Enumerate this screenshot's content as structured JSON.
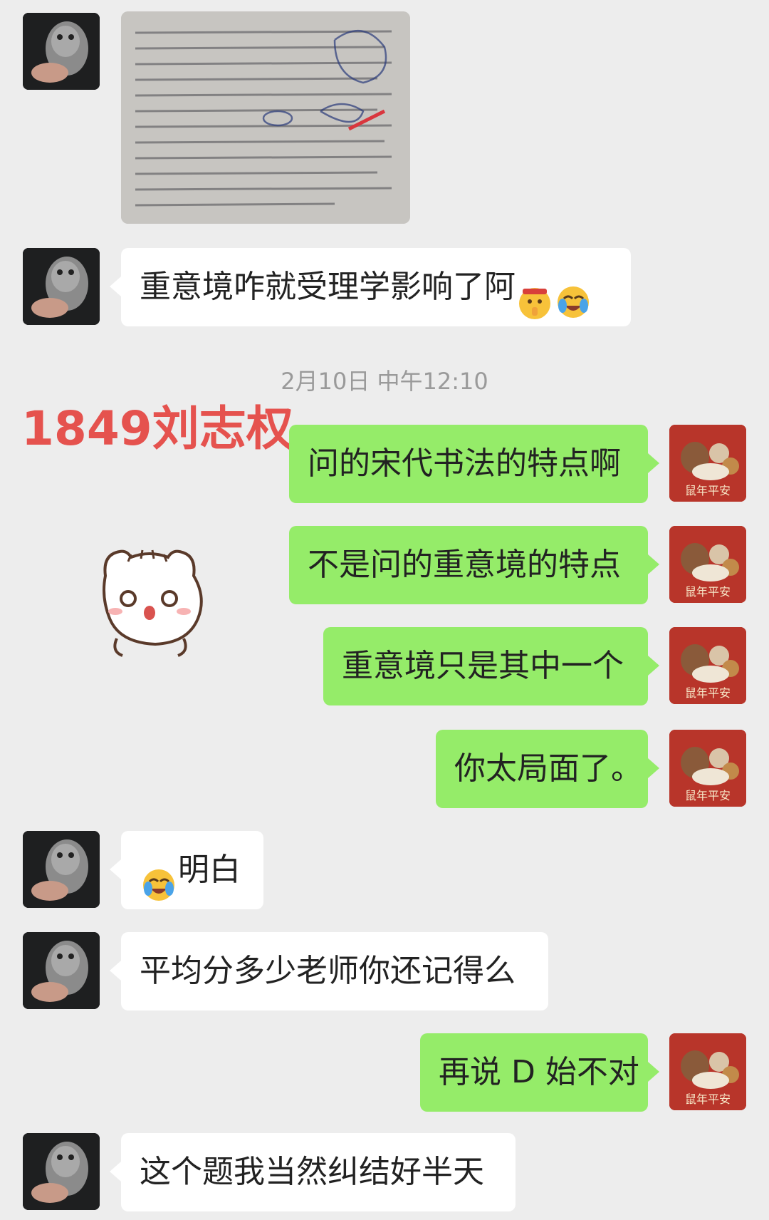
{
  "timestamp": "2月10日 中午12:10",
  "watermark": "1849刘志权",
  "messages": [
    {
      "side": "in",
      "type": "image",
      "content": "exam paper photo"
    },
    {
      "side": "in",
      "text": "重意境咋就受理学影响了阿",
      "emojis": [
        "shush-face-emoji",
        "crying-laugh-emoji"
      ]
    },
    {
      "side": "out",
      "text": "问的宋代书法的特点啊"
    },
    {
      "side": "out",
      "text": "不是问的重意境的特点"
    },
    {
      "side": "out",
      "text": "重意境只是其中一个"
    },
    {
      "side": "out",
      "text": "你太局面了。"
    },
    {
      "side": "in",
      "text": "明白",
      "emoji_before": "crying-laugh-emoji"
    },
    {
      "side": "in",
      "text": "平均分多少老师你还记得么"
    },
    {
      "side": "out",
      "text": "再说 D 始不对"
    },
    {
      "side": "in",
      "text": "这个题我当然纠结好半天"
    }
  ],
  "avatar_caption": "鼠年平安",
  "colors": {
    "background": "#ededed",
    "incoming_bubble": "#ffffff",
    "outgoing_bubble": "#95ec69",
    "watermark": "#e5524e"
  }
}
